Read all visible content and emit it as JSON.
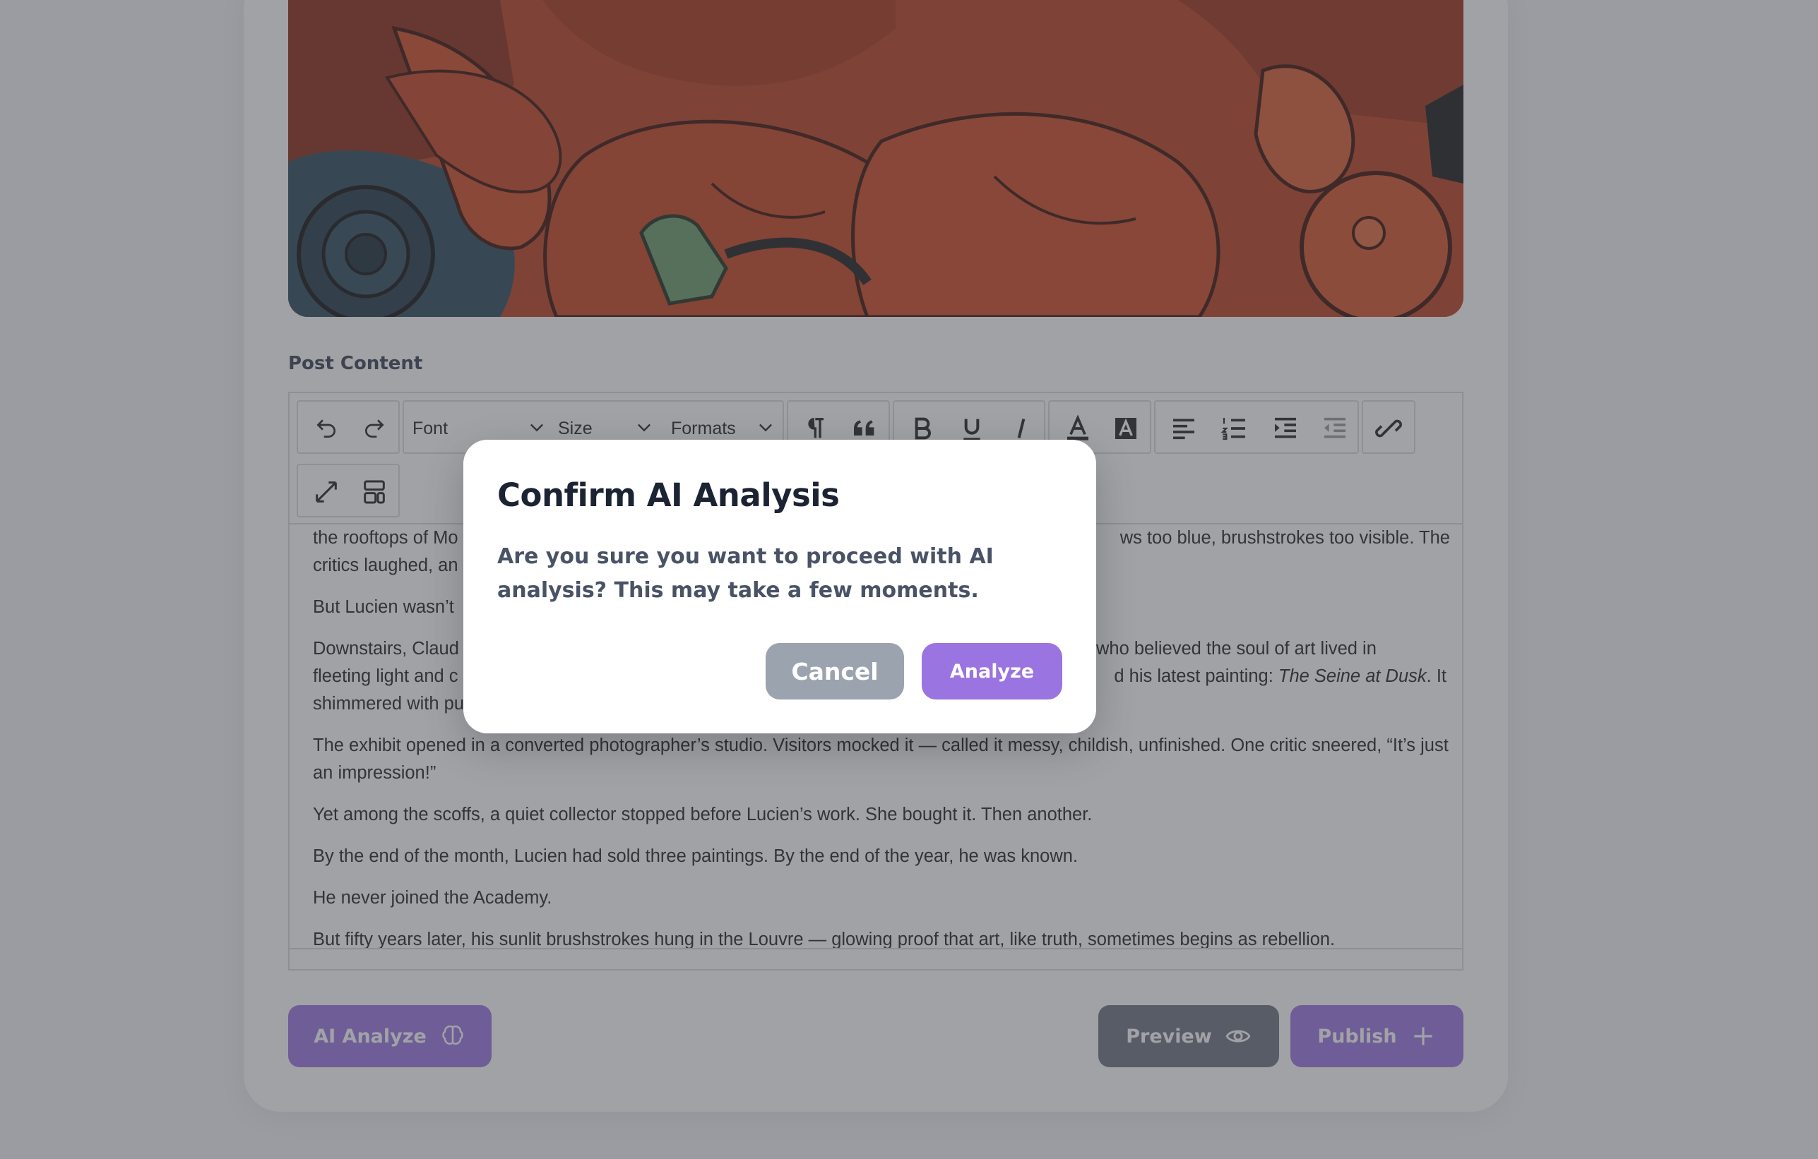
{
  "colors": {
    "accent": "#9a74e0",
    "accent_dark": "#7d53cf",
    "cancel_gray": "#9ba3af",
    "preview_gray": "#6c7280",
    "overlay": "rgba(68,70,78,0.5)"
  },
  "form": {
    "content_label": "Post Content"
  },
  "toolbar": {
    "font_label": "Font",
    "size_label": "Size",
    "formats_label": "Formats"
  },
  "editor": {
    "p1_a": "the rooftops of Mo",
    "p1_b": "ws too blue, brushstrokes too visible. The",
    "p1_c": "critics laughed, an",
    "p2": "But Lucien wasn’t",
    "p3_a": "Downstairs, Claud",
    "p3_b": "who believed the soul of art lived in",
    "p3_c": "fleeting light and c",
    "p3_d": "d his latest painting: ",
    "p3_italic": "The Seine at Dusk",
    "p3_e": ". It",
    "p3_f": "shimmered with pu",
    "p4": "The exhibit opened in a converted photographer’s studio. Visitors mocked it — called it messy, childish, unfinished. One critic sneered, “It’s just an impression!”",
    "p5": "Yet among the scoffs, a quiet collector stopped before Lucien’s work. She bought it. Then another.",
    "p6": "By the end of the month, Lucien had sold three paintings. By the end of the year, he was known.",
    "p7": "He never joined the Academy.",
    "p8": "But fifty years later, his sunlit brushstrokes hung in the Louvre — glowing proof that art, like truth, sometimes begins as rebellion."
  },
  "actions": {
    "ai_analyze": "AI Analyze",
    "preview": "Preview",
    "publish": "Publish"
  },
  "modal": {
    "title": "Confirm AI Analysis",
    "message": "Are you sure you want to proceed with AI analysis? This may take a few moments.",
    "cancel": "Cancel",
    "confirm": "Analyze"
  },
  "icons": {
    "undo": "undo-icon",
    "redo": "redo-icon",
    "paragraph": "pilcrow-icon",
    "quote": "blockquote-icon",
    "bold": "bold-icon",
    "underline": "underline-icon",
    "italic": "italic-icon",
    "text_color": "text-color-icon",
    "highlight": "background-color-icon",
    "align_left": "align-left-icon",
    "ordered_list": "ordered-list-icon",
    "indent": "indent-icon",
    "outdent": "outdent-icon",
    "unlink": "unlink-icon",
    "fullscreen": "fullscreen-icon",
    "layout": "layout-icon",
    "brain": "brain-icon",
    "eye": "eye-icon",
    "plus": "plus-icon"
  }
}
